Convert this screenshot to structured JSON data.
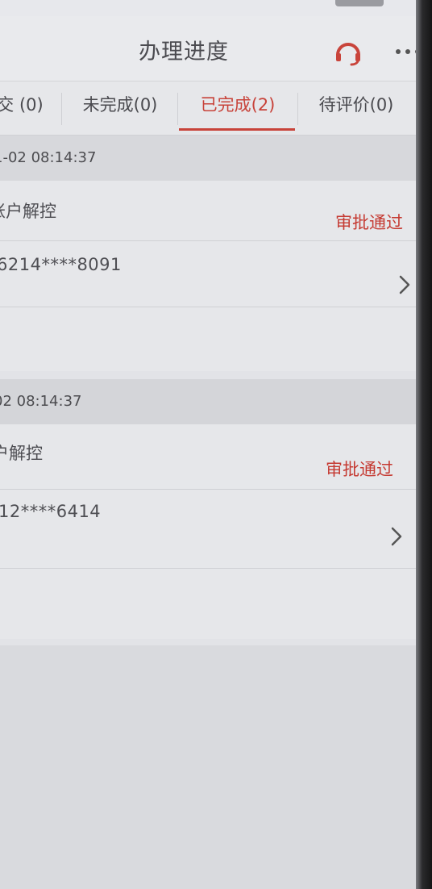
{
  "header": {
    "title": "办理进度",
    "support_icon": "headset-icon",
    "more_icon": "more-icon"
  },
  "tabs": [
    {
      "label": "交 (0)",
      "active": false
    },
    {
      "label": "未完成(0)",
      "active": false
    },
    {
      "label": "已完成(2)",
      "active": true
    },
    {
      "label": "待评价(0)",
      "active": false
    }
  ],
  "records": [
    {
      "datetime": "1-02 08:14:37",
      "business": "账户解控",
      "status": "审批通过",
      "account": "6214****8091"
    },
    {
      "datetime": "02 08:14:37",
      "business": "户解控",
      "status": "审批通过",
      "account": "12****6414"
    }
  ],
  "colors": {
    "accent": "#c8433a",
    "status_text": "#c53a32",
    "background": "#e2e3e7"
  }
}
